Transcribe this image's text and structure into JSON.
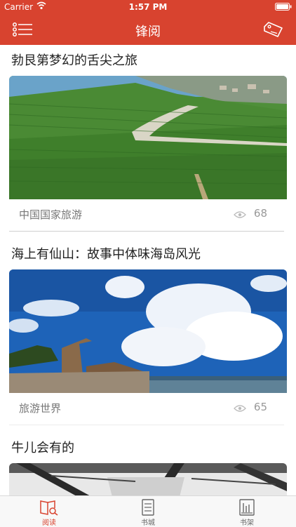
{
  "status_bar": {
    "carrier": "Carrier",
    "time": "1:57 PM"
  },
  "nav": {
    "title": "锋阅",
    "left_icon": "list-menu-icon",
    "right_icon": "tag-icon"
  },
  "articles": [
    {
      "title": "勃艮第梦幻的舌尖之旅",
      "source": "中国国家旅游",
      "views": "68",
      "image": "vineyard-photo"
    },
    {
      "title": "海上有仙山：故事中体味海岛风光",
      "source": "旅游世界",
      "views": "65",
      "image": "seaside-sky-photo"
    },
    {
      "title": "牛儿会有的",
      "image": "illustration-photo"
    }
  ],
  "tabs": [
    {
      "label": "阅读",
      "icon": "read-book-icon",
      "active": true
    },
    {
      "label": "书城",
      "icon": "document-icon",
      "active": false
    },
    {
      "label": "书架",
      "icon": "bookshelf-icon",
      "active": false
    }
  ],
  "colors": {
    "brand": "#d8432f",
    "active_tab": "#d8432f"
  }
}
